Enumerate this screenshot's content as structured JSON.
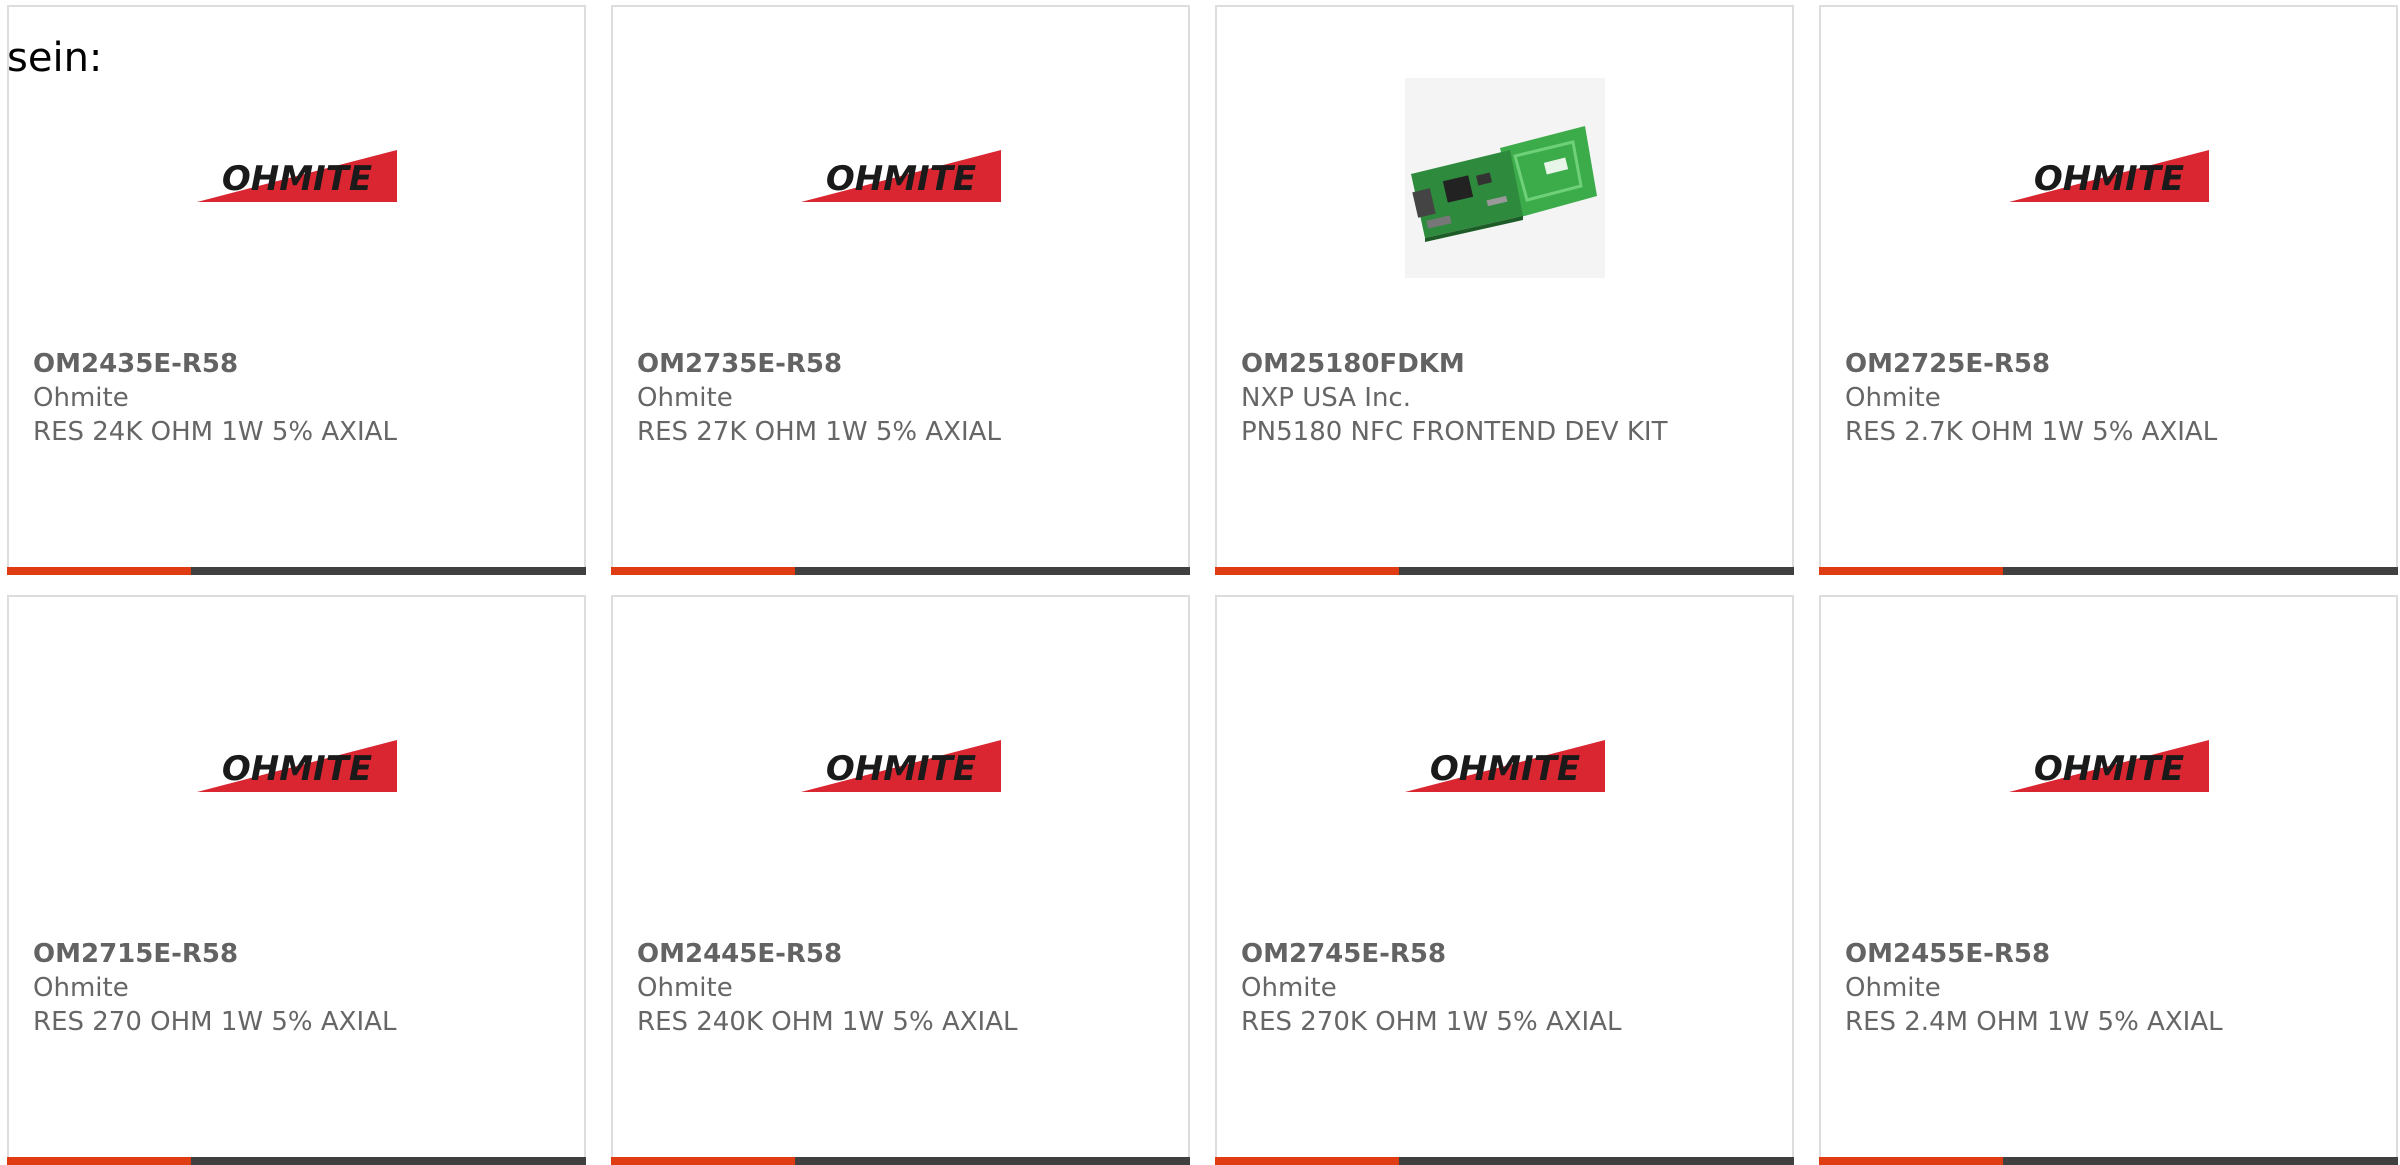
{
  "intro_text": "sein:",
  "colors": {
    "accent": "#e03c14",
    "bar": "#404040",
    "card_border": "#dddddd",
    "text": "#666666",
    "ohmite_red": "#d92631"
  },
  "products": [
    {
      "part_number": "OM2435E-R58",
      "manufacturer": "Ohmite",
      "description": "RES 24K OHM 1W 5% AXIAL",
      "image": "ohmite-logo",
      "logo_text": "OHMITE"
    },
    {
      "part_number": "OM2735E-R58",
      "manufacturer": "Ohmite",
      "description": "RES 27K OHM 1W 5% AXIAL",
      "image": "ohmite-logo",
      "logo_text": "OHMITE"
    },
    {
      "part_number": "OM25180FDKM",
      "manufacturer": "NXP USA Inc.",
      "description": "PN5180 NFC FRONTEND DEV KIT",
      "image": "nfc-dev-board-photo",
      "logo_text": ""
    },
    {
      "part_number": "OM2725E-R58",
      "manufacturer": "Ohmite",
      "description": "RES 2.7K OHM 1W 5% AXIAL",
      "image": "ohmite-logo",
      "logo_text": "OHMITE"
    },
    {
      "part_number": "OM2715E-R58",
      "manufacturer": "Ohmite",
      "description": "RES 270 OHM 1W 5% AXIAL",
      "image": "ohmite-logo",
      "logo_text": "OHMITE"
    },
    {
      "part_number": "OM2445E-R58",
      "manufacturer": "Ohmite",
      "description": "RES 240K OHM 1W 5% AXIAL",
      "image": "ohmite-logo",
      "logo_text": "OHMITE"
    },
    {
      "part_number": "OM2745E-R58",
      "manufacturer": "Ohmite",
      "description": "RES 270K OHM 1W 5% AXIAL",
      "image": "ohmite-logo",
      "logo_text": "OHMITE"
    },
    {
      "part_number": "OM2455E-R58",
      "manufacturer": "Ohmite",
      "description": "RES 2.4M OHM 1W 5% AXIAL",
      "image": "ohmite-logo",
      "logo_text": "OHMITE"
    }
  ]
}
